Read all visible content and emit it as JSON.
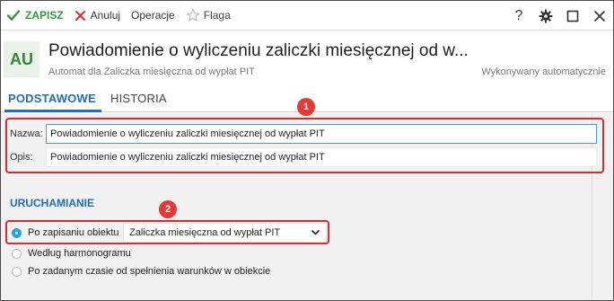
{
  "toolbar": {
    "save_label": "ZAPISZ",
    "cancel_label": "Anuluj",
    "operations_label": "Operacje",
    "flag_label": "Flaga",
    "help_icon": "?"
  },
  "header": {
    "badge": "AU",
    "title": "Powiadomienie o wyliczeniu zaliczki miesięcznej od w...",
    "subtitle": "Automat dla Zaliczka miesięczna od wypłat PIT",
    "status": "Wykonywany automatycznie"
  },
  "tabs": [
    {
      "label": "PODSTAWOWE",
      "active": true
    },
    {
      "label": "HISTORIA",
      "active": false
    }
  ],
  "fields": {
    "name_label": "Nazwa:",
    "name_value": "Powiadomienie o wyliczeniu zaliczki miesięcznej od wypłat PIT",
    "desc_label": "Opis:",
    "desc_value": "Powiadomienie o wyliczeniu zaliczki miesięcznej od wypłat PIT"
  },
  "annotations": {
    "first": "1",
    "second": "2"
  },
  "trigger": {
    "section_title": "URUCHAMIANIE",
    "options": [
      {
        "label": "Po zapisaniu obiektu",
        "selected": true
      },
      {
        "label": "Według harmonogramu",
        "selected": false
      },
      {
        "label": "Po zadanym czasie od spełnienia warunków w obiekcie",
        "selected": false
      }
    ],
    "object_select_value": "Zaliczka miesięczna od wypłat PIT"
  },
  "colors": {
    "accent": "#1f6fb2",
    "save_green": "#2e9a3c",
    "annotation_red": "#d32f2f",
    "radio_selected": "#29a3e0"
  }
}
